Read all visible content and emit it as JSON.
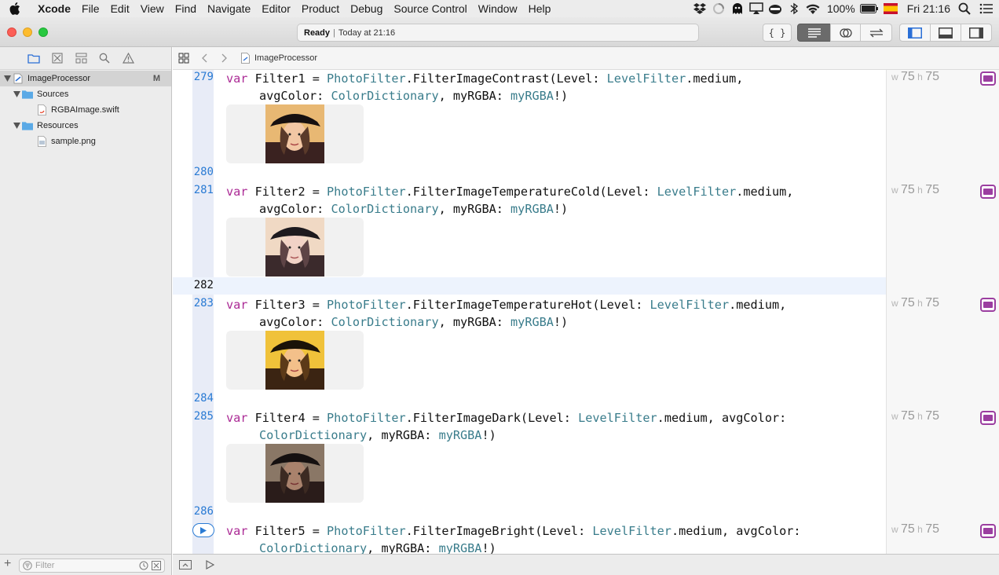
{
  "menubar": {
    "app_name": "Xcode",
    "items": [
      "File",
      "Edit",
      "View",
      "Find",
      "Navigate",
      "Editor",
      "Product",
      "Debug",
      "Source Control",
      "Window",
      "Help"
    ],
    "battery": "100%",
    "clock": "Fri 21:16"
  },
  "toolbar": {
    "activity_status": "Ready",
    "activity_time": "Today at 21:16"
  },
  "navigator": {
    "project": {
      "name": "ImageProcessor",
      "badge": "M"
    },
    "groups": [
      {
        "name": "Sources",
        "files": [
          "RGBAImage.swift"
        ]
      },
      {
        "name": "Resources",
        "files": [
          "sample.png"
        ]
      }
    ],
    "filter_placeholder": "Filter"
  },
  "jumpbar": {
    "crumb": "ImageProcessor"
  },
  "editor": {
    "line_numbers": {
      "l279": "279",
      "l280": "280",
      "l281": "281",
      "l282": "282",
      "l283": "283",
      "l284": "284",
      "l285": "285",
      "l286": "286"
    },
    "code": {
      "f1a": [
        "var",
        " Filter1 = ",
        "PhotoFilter",
        ".FilterImageContrast(Level: ",
        "LevelFilter",
        ".medium,"
      ],
      "f1b": [
        "avgColor: ",
        "ColorDictionary",
        ", myRGBA: ",
        "myRGBA",
        "!)"
      ],
      "f2a": [
        "var",
        " Filter2 = ",
        "PhotoFilter",
        ".FilterImageTemperatureCold(Level: ",
        "LevelFilter",
        ".medium,"
      ],
      "f2b": [
        "avgColor: ",
        "ColorDictionary",
        ", myRGBA: ",
        "myRGBA",
        "!)"
      ],
      "f3a": [
        "var",
        " Filter3 = ",
        "PhotoFilter",
        ".FilterImageTemperatureHot(Level: ",
        "LevelFilter",
        ".medium,"
      ],
      "f3b": [
        "avgColor: ",
        "ColorDictionary",
        ", myRGBA: ",
        "myRGBA",
        "!)"
      ],
      "f4a": [
        "var",
        " Filter4 = ",
        "PhotoFilter",
        ".FilterImageDark(Level: ",
        "LevelFilter",
        ".medium, avgColor:"
      ],
      "f4b": [
        "ColorDictionary",
        ", myRGBA: ",
        "myRGBA",
        "!)"
      ],
      "f5a": [
        "var",
        " Filter5 = ",
        "PhotoFilter",
        ".FilterImageBright(Level: ",
        "LevelFilter",
        ".medium, avgColor:"
      ],
      "f5b": [
        "ColorDictionary",
        ", myRGBA: ",
        "myRGBA",
        "!)"
      ]
    },
    "results": {
      "w_label": "w",
      "h_label": "h",
      "r1": {
        "w": "75",
        "h": "75"
      },
      "r2": {
        "w": "75",
        "h": "75"
      },
      "r3": {
        "w": "75",
        "h": "75"
      },
      "r4": {
        "w": "75",
        "h": "75"
      },
      "r5": {
        "w": "75",
        "h": "75"
      }
    }
  },
  "colors": {
    "keyword": "#ab2a95",
    "type": "#397c8b",
    "line_number": "#2a7bd4",
    "quicklook": "#9b3ea0"
  }
}
